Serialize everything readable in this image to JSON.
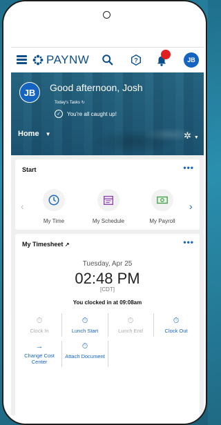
{
  "nav": {
    "brand": "PAYNW",
    "avatar_initials": "JB"
  },
  "hero": {
    "avatar_initials": "JB",
    "greeting": "Good afternoon, Josh",
    "todays_tasks": "Today's Tasks",
    "caught_up": "You're all caught up!",
    "home_label": "Home"
  },
  "start": {
    "title": "Start",
    "items": [
      {
        "label": "My Time"
      },
      {
        "label": "My Schedule"
      },
      {
        "label": "My Payroll"
      }
    ]
  },
  "timesheet": {
    "title": "My Timesheet",
    "day": "Tuesday, Apr 25",
    "time": "02:48 PM",
    "zone": "[CDT]",
    "clocked": "You clocked in at 09:08am",
    "actions": [
      {
        "label": "Clock In"
      },
      {
        "label": "Lunch Start"
      },
      {
        "label": "Lunch End"
      },
      {
        "label": "Clock Out"
      },
      {
        "label": "Change Cost Center"
      },
      {
        "label": "Attach Document"
      }
    ]
  },
  "colors": {
    "brand_blue": "#0b4f8a",
    "accent_blue": "#1565c0",
    "notification_red": "#e02020"
  }
}
